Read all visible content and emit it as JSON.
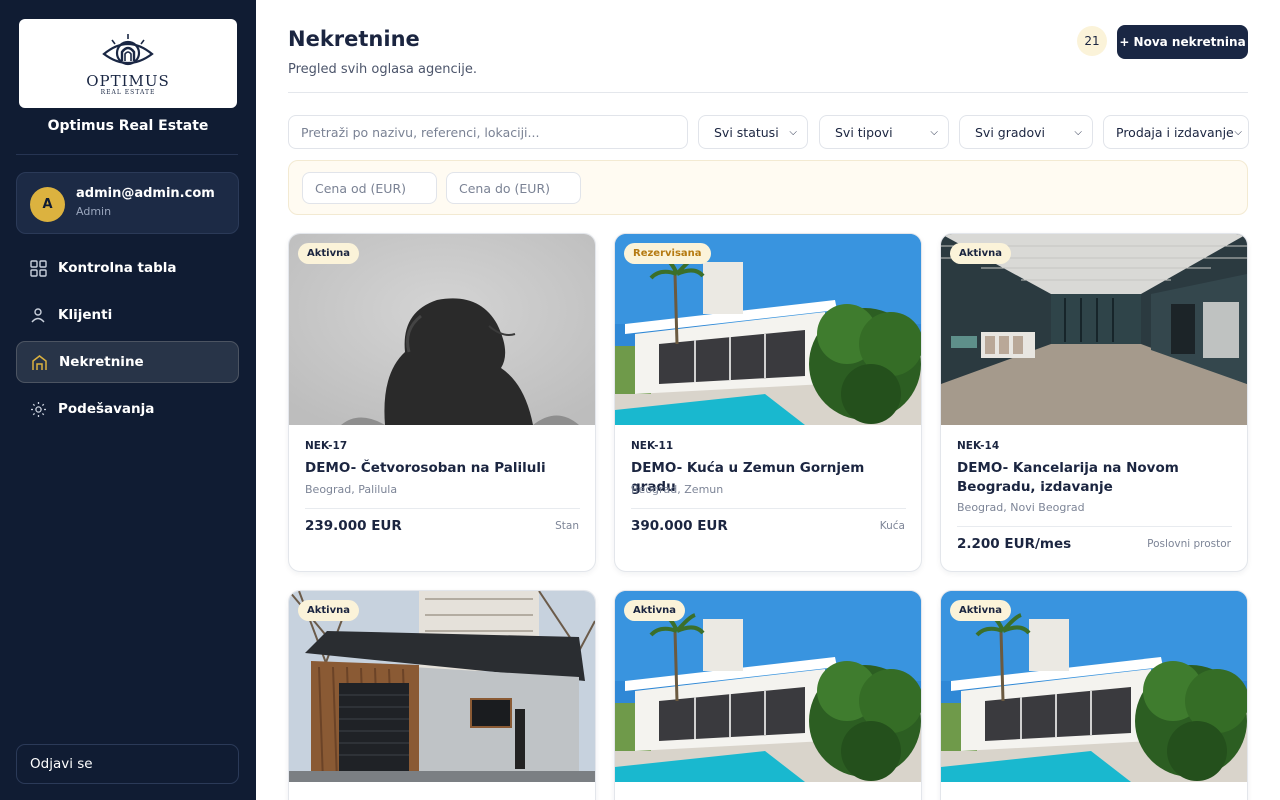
{
  "sidebar": {
    "logo_word": "OPTIMUS",
    "logo_sub": "REAL ESTATE",
    "brand_name": "Optimus Real Estate",
    "user": {
      "initial": "A",
      "email": "admin@admin.com",
      "role": "Admin"
    },
    "nav": [
      {
        "label": "Kontrolna tabla",
        "icon": "grid-icon"
      },
      {
        "label": "Klijenti",
        "icon": "user-icon"
      },
      {
        "label": "Nekretnine",
        "icon": "home-icon",
        "active": true
      },
      {
        "label": "Podešavanja",
        "icon": "sun-gear-icon"
      }
    ],
    "logout_label": "Odjavi se"
  },
  "header": {
    "title": "Nekretnine",
    "subtitle": "Pregled svih oglasa agencije.",
    "count": "21",
    "new_button": "+ Nova nekretnina"
  },
  "filters": {
    "search_placeholder": "Pretraži po nazivu, referenci, lokaciji...",
    "status": "Svi statusi",
    "type": "Svi tipovi",
    "city": "Svi gradovi",
    "transaction": "Prodaja i izdavanje",
    "price_from_placeholder": "Cena od (EUR)",
    "price_to_placeholder": "Cena do (EUR)"
  },
  "colors": {
    "sidebar_bg": "#101c33",
    "accent_gold": "#dcb23f",
    "badge_bg": "#fbf3d9",
    "reserved_text": "#b57a12",
    "primary_button": "#1a2744"
  },
  "properties": [
    {
      "status": "Aktivna",
      "ref": "NEK-17",
      "title": "DEMO- Četvorosoban na Paliluli",
      "location": "Beograd, Palilula",
      "price": "239.000 EUR",
      "type": "Stan",
      "image": "grayscale-woman-photo"
    },
    {
      "status": "Rezervisana",
      "ref": "NEK-11",
      "title": "DEMO- Kuća u Zemun Gornjem gradu",
      "location": "Beograd, Zemun",
      "price": "390.000 EUR",
      "type": "Kuća",
      "image": "modern-villa-pool-photo"
    },
    {
      "status": "Aktivna",
      "ref": "NEK-14",
      "title": "DEMO- Kancelarija na Novom Beogradu, izdavanje",
      "location": "Beograd, Novi Beograd",
      "price": "2.200 EUR/mes",
      "type": "Poslovni prostor",
      "image": "office-interior-photo"
    },
    {
      "status": "Aktivna",
      "image": "garage-building-photo"
    },
    {
      "status": "Aktivna",
      "image": "modern-villa-pool-photo"
    },
    {
      "status": "Aktivna",
      "image": "modern-villa-pool-photo"
    }
  ]
}
